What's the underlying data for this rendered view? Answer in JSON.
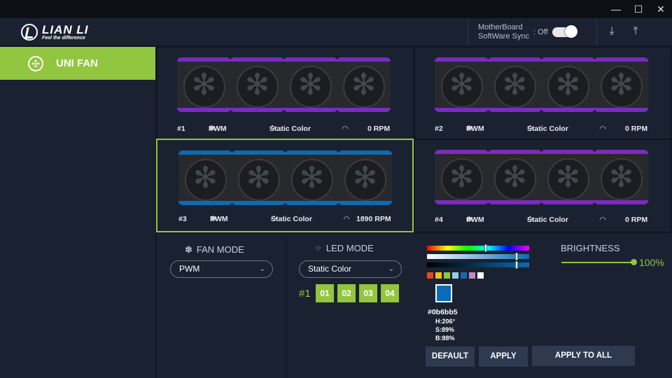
{
  "window": {
    "minimize": "—",
    "maximize": "☐",
    "close": "✕"
  },
  "header": {
    "brand": "LIAN LI",
    "tagline": "Feel the difference",
    "sync_label_1": "MotherBoard",
    "sync_label_2": "SoftWare Sync",
    "sync_state": ": Off",
    "download_icon": "⤓",
    "upload_icon": "⤒"
  },
  "sidebar": {
    "items": [
      {
        "label": "UNI FAN",
        "icon": "✣"
      }
    ]
  },
  "panels": [
    {
      "id": "#1",
      "fan_mode": "PWM",
      "led_mode": "Static Color",
      "rpm": "0 RPM",
      "led_color": "#7a2bbf"
    },
    {
      "id": "#2",
      "fan_mode": "PWM",
      "led_mode": "Static Color",
      "rpm": "0 RPM",
      "led_color": "#7a2bbf"
    },
    {
      "id": "#3",
      "fan_mode": "PWM",
      "led_mode": "Static Color",
      "rpm": "1890 RPM",
      "led_color": "#0b6bb5"
    },
    {
      "id": "#4",
      "fan_mode": "PWM",
      "led_mode": "Static Color",
      "rpm": "0 RPM",
      "led_color": "#7a2bbf"
    }
  ],
  "fan_mode": {
    "title": "FAN MODE",
    "selected": "PWM"
  },
  "led_mode": {
    "title": "LED MODE",
    "selected": "Static Color",
    "group_label": "#1",
    "zones": [
      "01",
      "02",
      "03",
      "04"
    ]
  },
  "color": {
    "hex": "#0b6bb5",
    "h": "H:206°",
    "s": "S:89%",
    "b": "B:88%",
    "presets": [
      "#e14b1f",
      "#f0c419",
      "#92c540",
      "#8fd0e8",
      "#1a64b0",
      "#c58ac0",
      "#ffffff"
    ]
  },
  "buttons": {
    "default": "DEFAULT",
    "apply": "APPLY",
    "apply_all": "APPLY TO ALL"
  },
  "brightness": {
    "title": "BRIGHTNESS",
    "value": "100%",
    "level": 1.0
  },
  "accent": "#92c540"
}
